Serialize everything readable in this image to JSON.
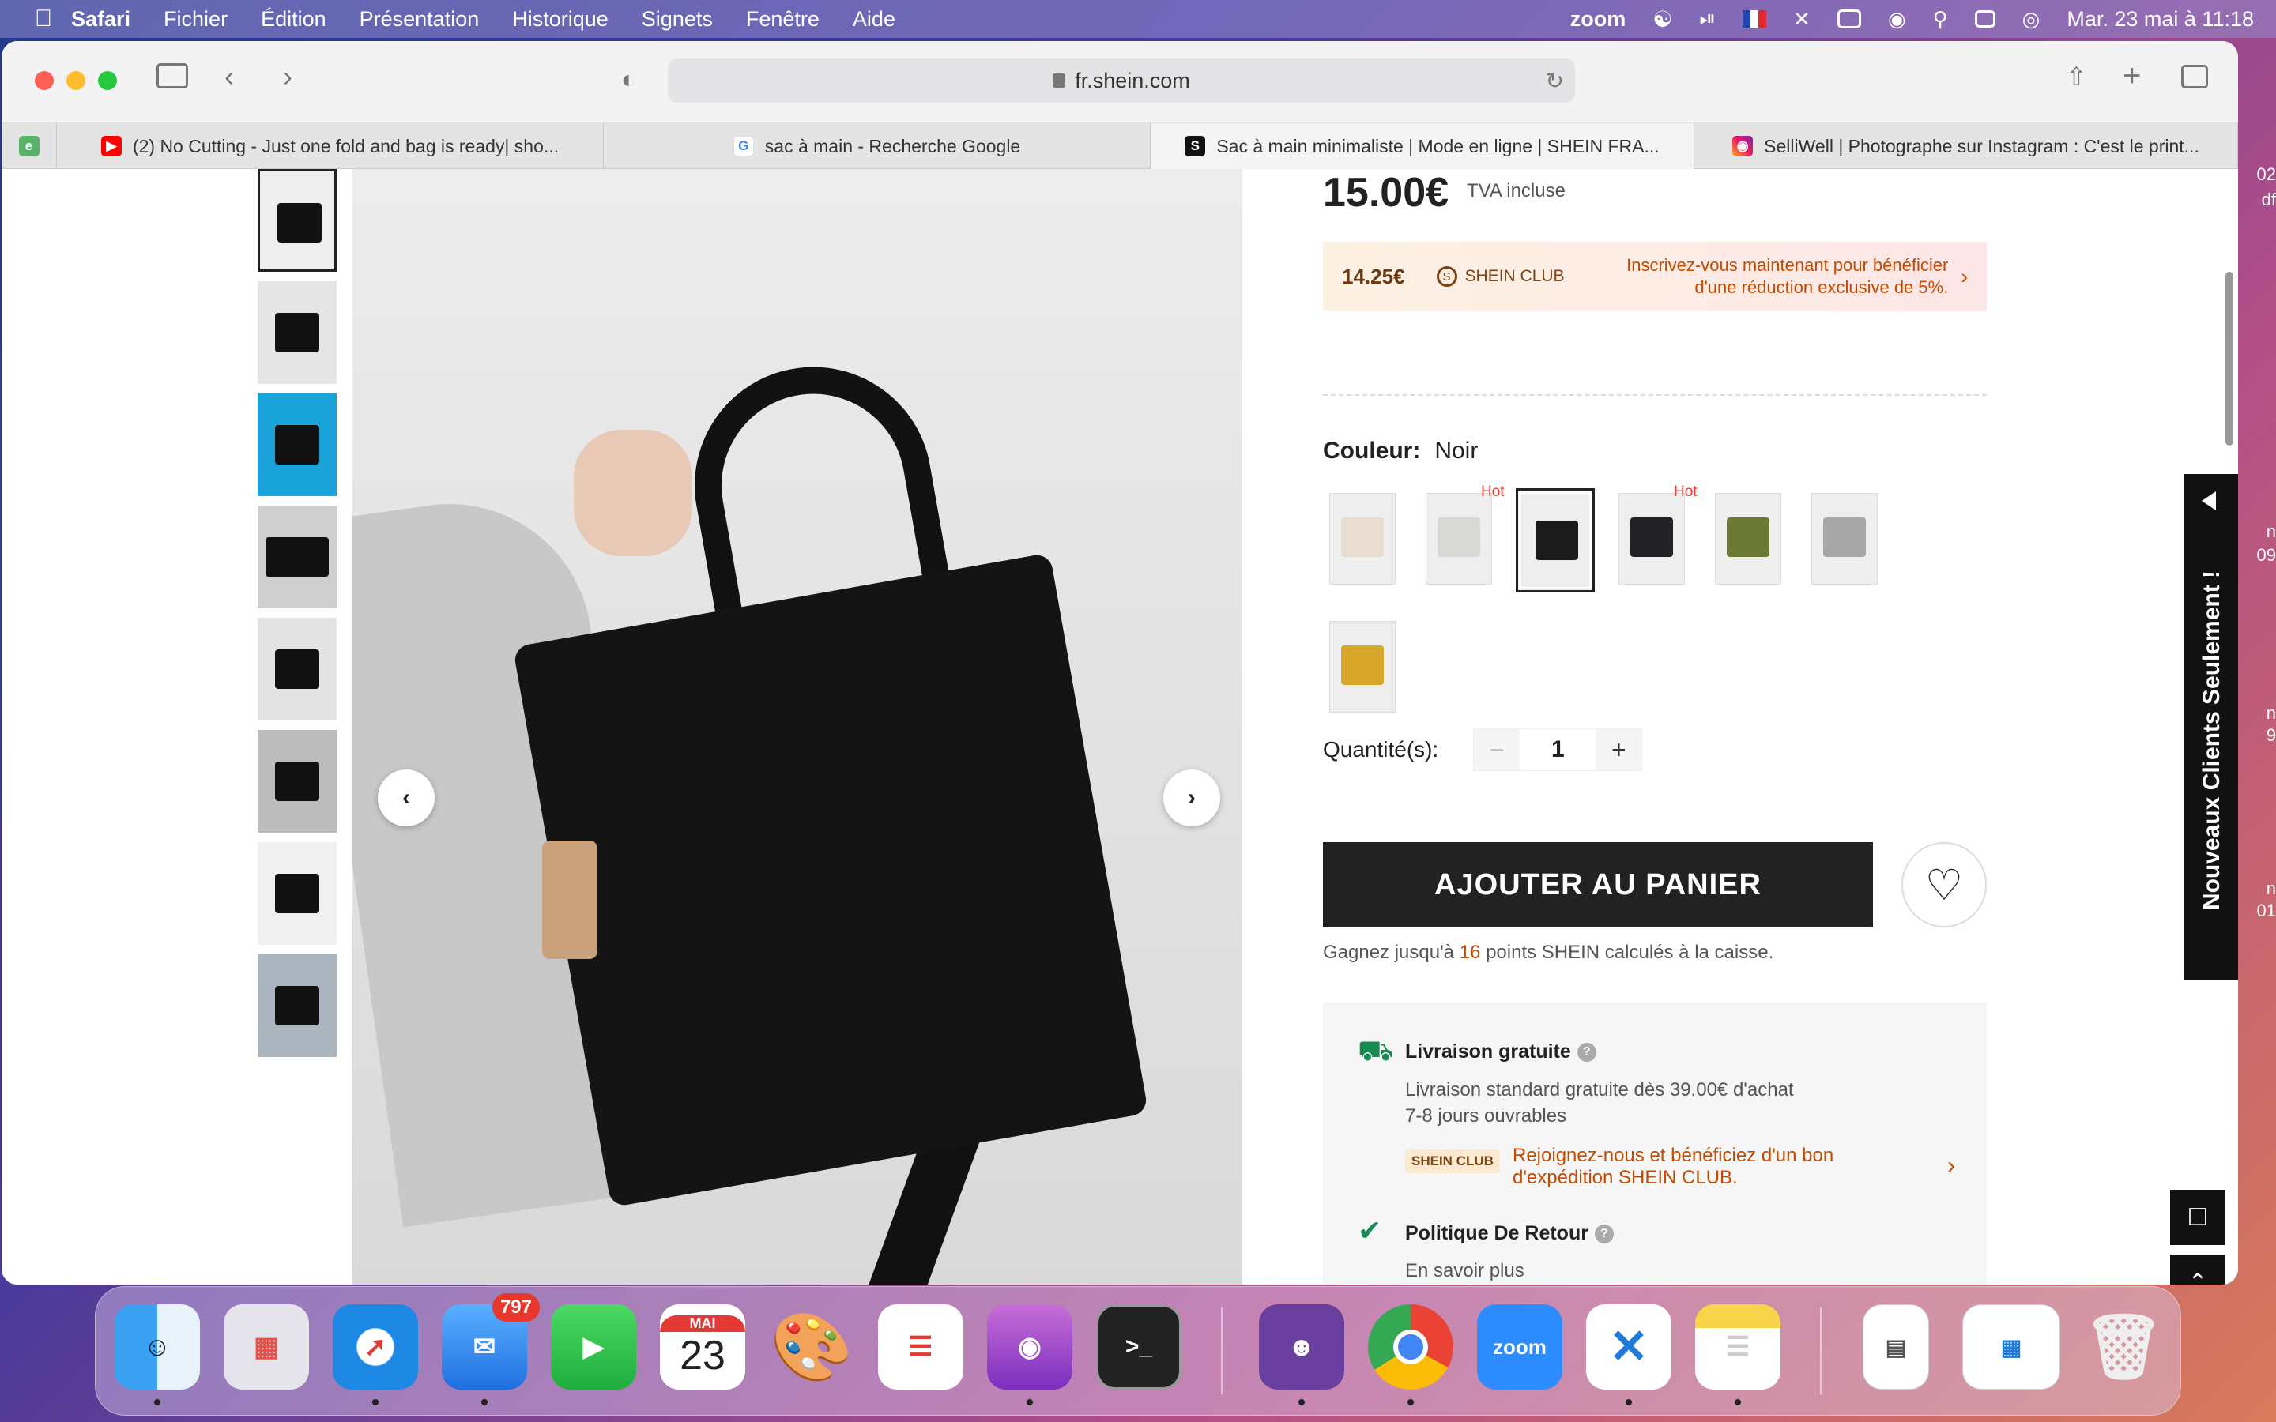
{
  "menubar": {
    "app": "Safari",
    "items": [
      "Fichier",
      "Édition",
      "Présentation",
      "Historique",
      "Signets",
      "Fenêtre",
      "Aide"
    ],
    "zoom": "zoom",
    "datetime": "Mar. 23 mai à  11:18"
  },
  "browser": {
    "url": "fr.shein.com",
    "tabs": [
      {
        "label": "(2) No Cutting - Just one fold and bag is ready| sho...",
        "icon": "youtube-icon"
      },
      {
        "label": "sac à main - Recherche Google",
        "icon": "google-icon"
      },
      {
        "label": "Sac à main minimaliste | Mode en ligne | SHEIN FRA...",
        "icon": "shein-icon"
      },
      {
        "label": "SelliWell | Photographe sur Instagram : C'est le print...",
        "icon": "instagram-icon"
      }
    ]
  },
  "product": {
    "price": "15.00€",
    "tva": "TVA incluse",
    "club_price": "14.25€",
    "club_label": "SHEIN CLUB",
    "club_message_line1": "Inscrivez-vous maintenant pour bénéficier",
    "club_message_line2": "d'une réduction exclusive de 5%.",
    "color_label": "Couleur:",
    "color_value": "Noir",
    "hot_label": "Hot",
    "swatches": [
      {
        "color": "#e8ddd0",
        "hot": false
      },
      {
        "color": "#d8d8d4",
        "hot": true
      },
      {
        "color": "#1a1a1a",
        "hot": false,
        "selected": true
      },
      {
        "color": "#222226",
        "hot": true
      },
      {
        "color": "#6b7a35",
        "hot": false
      },
      {
        "color": "#a8a8a8",
        "hot": false
      },
      {
        "color": "#d8a628",
        "hot": false
      }
    ],
    "quantity_label": "Quantité(s):",
    "quantity": "1",
    "minus": "−",
    "plus": "+",
    "add_to_cart": "AJOUTER AU PANIER",
    "points_prefix": "Gagnez jusqu'à",
    "points_value": "16",
    "points_suffix": "points SHEIN calculés à la caisse.",
    "shipping_title": "Livraison gratuite",
    "shipping_line1": "Livraison standard gratuite dès 39.00€ d'achat",
    "shipping_line2": "7-8 jours ouvrables",
    "shipping_club_badge": "SHEIN CLUB",
    "shipping_join_line1": "Rejoignez-nous et bénéficiez d'un bon",
    "shipping_join_line2": "d'expédition SHEIN CLUB.",
    "return_title": "Politique De Retour",
    "return_link": "En savoir plus"
  },
  "side_banner": "Nouveaux Clients Seulement !",
  "desktop_text": [
    "02",
    "df",
    "n",
    "09",
    "n",
    "9",
    "n",
    "01"
  ],
  "dock": {
    "mail_badge": "797",
    "calendar_month": "MAI",
    "calendar_day": "23",
    "zoom_label": "zoom",
    "terminal_label": ">_"
  }
}
